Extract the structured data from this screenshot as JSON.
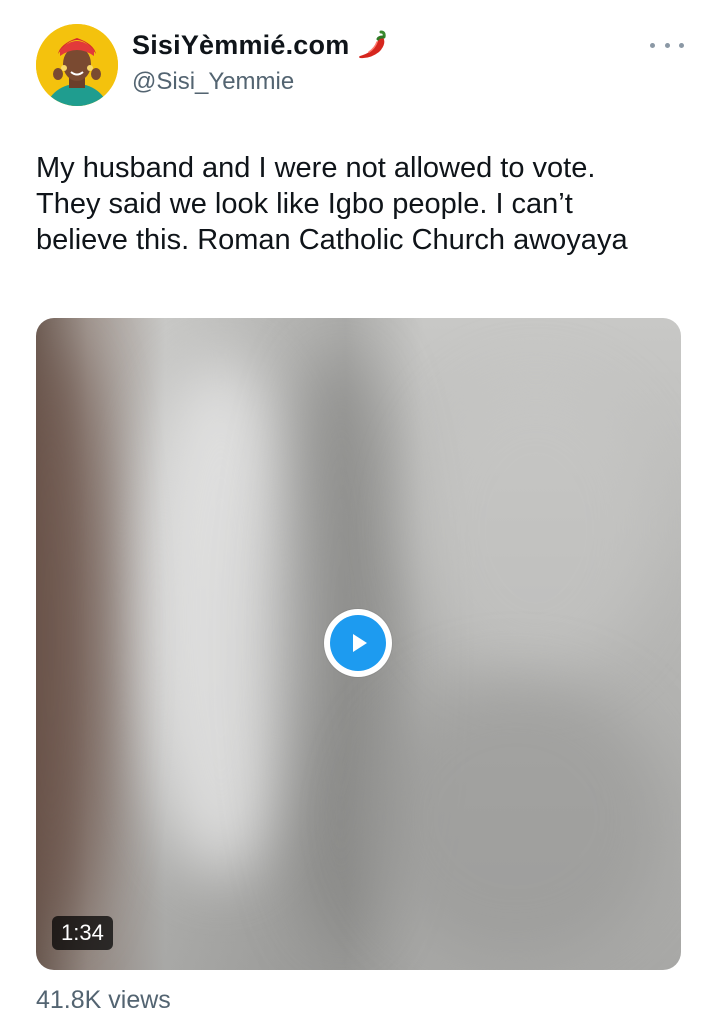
{
  "author": {
    "display_name": "SisiYèmmié.com",
    "handle": "@Sisi_Yemmie",
    "avatar_icon": "profile-photo",
    "badge_icon": "chili-pepper-icon"
  },
  "tweet": {
    "text_lines": [
      "My husband and I were not allowed to vote.",
      "They said we look like Igbo people. I can’t",
      "believe this. Roman Catholic Church awoyaya"
    ]
  },
  "media": {
    "type": "video",
    "duration": "1:34",
    "play_icon": "play-icon"
  },
  "stats": {
    "views": "41.8K views"
  },
  "colors": {
    "accent": "#1d9bf0",
    "text": "#0f1419",
    "secondary_text": "#536471"
  }
}
